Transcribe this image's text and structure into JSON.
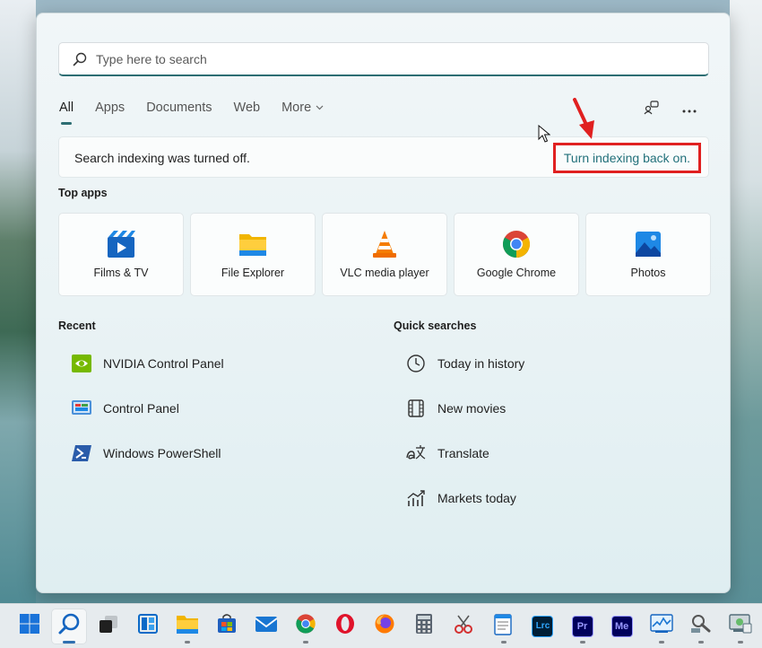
{
  "search": {
    "placeholder": "Type here to search"
  },
  "tabs": [
    {
      "label": "All"
    },
    {
      "label": "Apps"
    },
    {
      "label": "Documents"
    },
    {
      "label": "Web"
    },
    {
      "label": "More"
    }
  ],
  "notice": {
    "text": "Search indexing was turned off.",
    "link": "Turn indexing back on."
  },
  "top_apps": {
    "title": "Top apps",
    "items": [
      {
        "label": "Films & TV",
        "icon": "films-tv-icon"
      },
      {
        "label": "File Explorer",
        "icon": "file-explorer-icon"
      },
      {
        "label": "VLC media player",
        "icon": "vlc-icon"
      },
      {
        "label": "Google Chrome",
        "icon": "chrome-icon"
      },
      {
        "label": "Photos",
        "icon": "photos-icon"
      }
    ]
  },
  "recent": {
    "title": "Recent",
    "items": [
      {
        "label": "NVIDIA Control Panel",
        "icon": "nvidia-icon"
      },
      {
        "label": "Control Panel",
        "icon": "control-panel-icon"
      },
      {
        "label": "Windows PowerShell",
        "icon": "powershell-icon"
      }
    ]
  },
  "quick_searches": {
    "title": "Quick searches",
    "items": [
      {
        "label": "Today in history",
        "icon": "clock-icon"
      },
      {
        "label": "New movies",
        "icon": "film-icon"
      },
      {
        "label": "Translate",
        "icon": "translate-icon"
      },
      {
        "label": "Markets today",
        "icon": "chart-icon"
      }
    ]
  },
  "taskbar": {
    "icons": [
      "start-icon",
      "search-icon",
      "task-view-icon",
      "widgets-icon",
      "file-explorer-icon",
      "store-icon",
      "mail-icon",
      "chrome-icon",
      "opera-icon",
      "firefox-icon",
      "calculator-icon",
      "snipping-icon",
      "notepad-icon",
      "lightroom-icon",
      "premiere-icon",
      "media-encoder-icon",
      "performance-monitor-icon",
      "network-icon",
      "system-icon"
    ],
    "labels": {
      "lightroom": "Lrc",
      "premiere": "Pr",
      "media_encoder": "Me"
    }
  },
  "colors": {
    "accent": "#2d6e73",
    "link": "#22707a",
    "highlight_box": "#e02020"
  }
}
